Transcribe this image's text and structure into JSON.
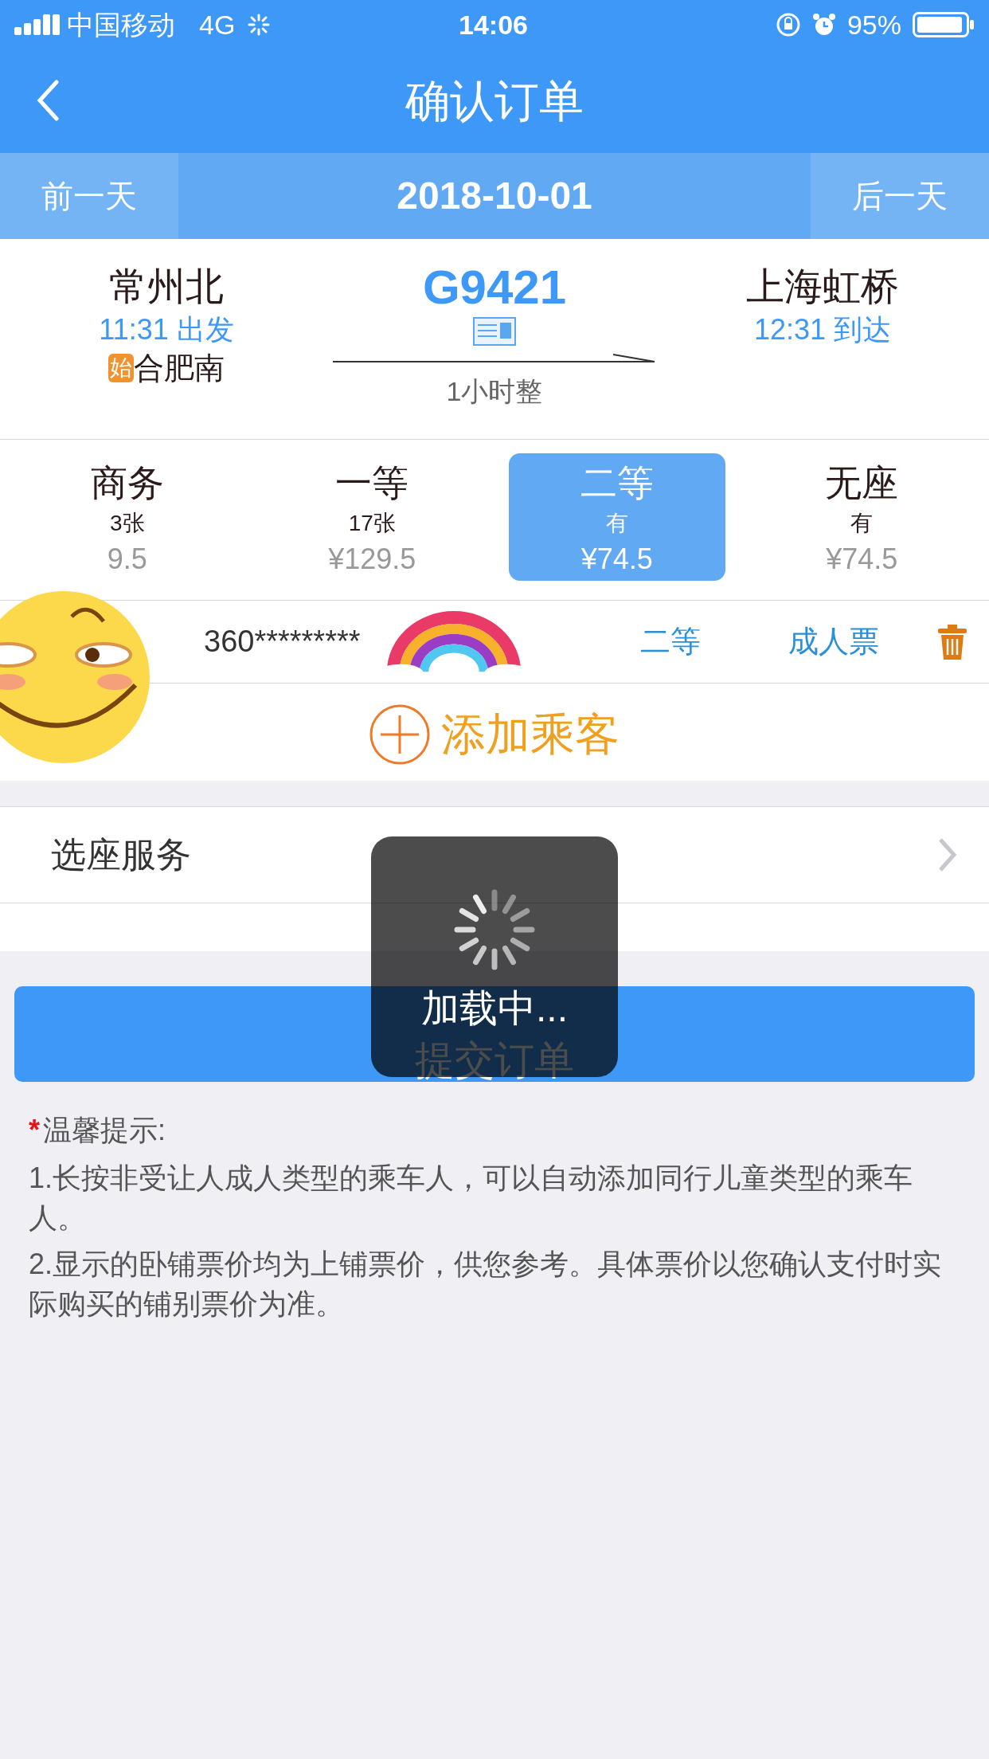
{
  "status_bar": {
    "carrier": "中国移动",
    "network": "4G",
    "time": "14:06",
    "battery": "95%"
  },
  "nav": {
    "title": "确认订单"
  },
  "date_bar": {
    "prev": "前一天",
    "date": "2018-10-01",
    "next": "后一天"
  },
  "train": {
    "from": "常州北",
    "depart": "11:31 出发",
    "origin_badge": "始",
    "origin": "合肥南",
    "number": "G9421",
    "duration": "1小时整",
    "to": "上海虹桥",
    "arrive": "12:31 到达"
  },
  "seats": [
    {
      "name": "商务",
      "count": "3张",
      "price": "9.5",
      "selected": false
    },
    {
      "name": "一等",
      "count": "17张",
      "price": "¥129.5",
      "selected": false
    },
    {
      "name": "二等",
      "count": "有",
      "price": "¥74.5",
      "selected": true
    },
    {
      "name": "无座",
      "count": "有",
      "price": "¥74.5",
      "selected": false
    }
  ],
  "passenger": {
    "id": "360*********",
    "seat": "二等",
    "ticket_type": "成人票"
  },
  "add_passenger": "添加乘客",
  "seat_service": "选座服务",
  "submit": "提交订单",
  "loading": "加载中...",
  "tips": {
    "marker": "*",
    "title": "温馨提示:",
    "items": [
      "1.长按非受让人成人类型的乘车人，可以自动添加同行儿童类型的乘车人。",
      "2.显示的卧铺票价均为上铺票价，供您参考。具体票价以您确认支付时实际购买的铺别票价为准。"
    ]
  }
}
